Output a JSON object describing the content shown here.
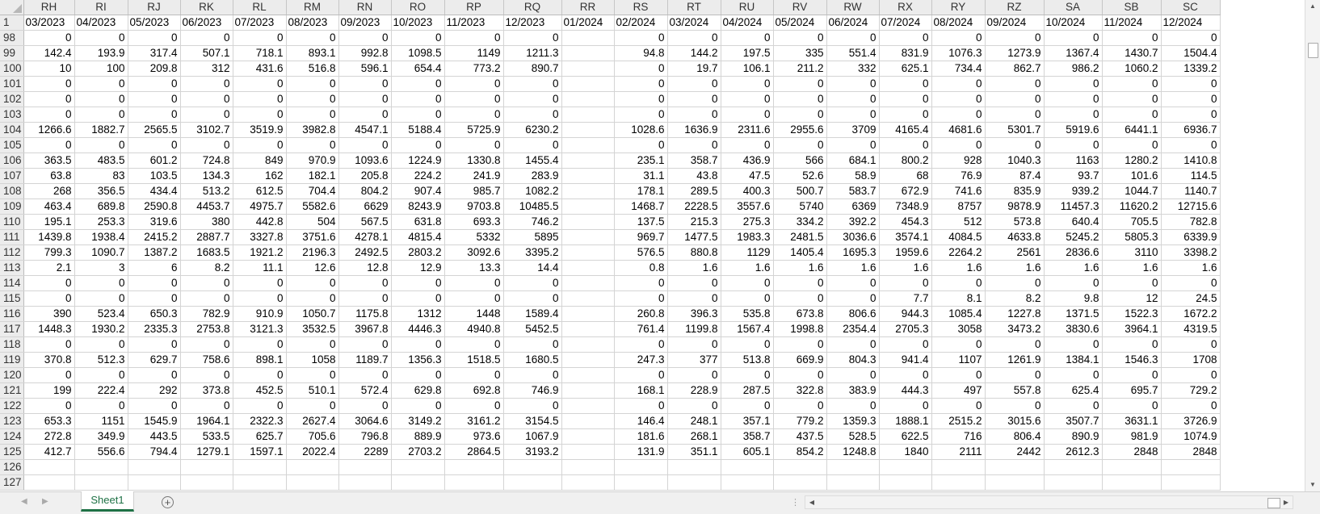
{
  "sheet": {
    "column_headers": [
      "RH",
      "RI",
      "RJ",
      "RK",
      "RL",
      "RM",
      "RN",
      "RO",
      "RP",
      "RQ",
      "RR",
      "RS",
      "RT",
      "RU",
      "RV",
      "RW",
      "RX",
      "RY",
      "RZ",
      "SA",
      "SB",
      "SC"
    ],
    "rows": [
      {
        "row": "1",
        "cells": [
          "03/2023",
          "04/2023",
          "05/2023",
          "06/2023",
          "07/2023",
          "08/2023",
          "09/2023",
          "10/2023",
          "11/2023",
          "12/2023",
          "01/2024",
          "02/2024",
          "03/2024",
          "04/2024",
          "05/2024",
          "06/2024",
          "07/2024",
          "08/2024",
          "09/2024",
          "10/2024",
          "11/2024",
          "12/2024"
        ]
      },
      {
        "row": "98",
        "cells": [
          "0",
          "0",
          "0",
          "0",
          "0",
          "0",
          "0",
          "0",
          "0",
          "0",
          "",
          "0",
          "0",
          "0",
          "0",
          "0",
          "0",
          "0",
          "0",
          "0",
          "0",
          "0"
        ]
      },
      {
        "row": "99",
        "cells": [
          "142.4",
          "193.9",
          "317.4",
          "507.1",
          "718.1",
          "893.1",
          "992.8",
          "1098.5",
          "1149",
          "1211.3",
          "",
          "94.8",
          "144.2",
          "197.5",
          "335",
          "551.4",
          "831.9",
          "1076.3",
          "1273.9",
          "1367.4",
          "1430.7",
          "1504.4"
        ]
      },
      {
        "row": "100",
        "cells": [
          "10",
          "100",
          "209.8",
          "312",
          "431.6",
          "516.8",
          "596.1",
          "654.4",
          "773.2",
          "890.7",
          "",
          "0",
          "19.7",
          "106.1",
          "211.2",
          "332",
          "625.1",
          "734.4",
          "862.7",
          "986.2",
          "1060.2",
          "1339.2"
        ]
      },
      {
        "row": "101",
        "cells": [
          "0",
          "0",
          "0",
          "0",
          "0",
          "0",
          "0",
          "0",
          "0",
          "0",
          "",
          "0",
          "0",
          "0",
          "0",
          "0",
          "0",
          "0",
          "0",
          "0",
          "0",
          "0"
        ]
      },
      {
        "row": "102",
        "cells": [
          "0",
          "0",
          "0",
          "0",
          "0",
          "0",
          "0",
          "0",
          "0",
          "0",
          "",
          "0",
          "0",
          "0",
          "0",
          "0",
          "0",
          "0",
          "0",
          "0",
          "0",
          "0"
        ]
      },
      {
        "row": "103",
        "cells": [
          "0",
          "0",
          "0",
          "0",
          "0",
          "0",
          "0",
          "0",
          "0",
          "0",
          "",
          "0",
          "0",
          "0",
          "0",
          "0",
          "0",
          "0",
          "0",
          "0",
          "0",
          "0"
        ]
      },
      {
        "row": "104",
        "cells": [
          "1266.6",
          "1882.7",
          "2565.5",
          "3102.7",
          "3519.9",
          "3982.8",
          "4547.1",
          "5188.4",
          "5725.9",
          "6230.2",
          "",
          "1028.6",
          "1636.9",
          "2311.6",
          "2955.6",
          "3709",
          "4165.4",
          "4681.6",
          "5301.7",
          "5919.6",
          "6441.1",
          "6936.7"
        ]
      },
      {
        "row": "105",
        "cells": [
          "0",
          "0",
          "0",
          "0",
          "0",
          "0",
          "0",
          "0",
          "0",
          "0",
          "",
          "0",
          "0",
          "0",
          "0",
          "0",
          "0",
          "0",
          "0",
          "0",
          "0",
          "0"
        ]
      },
      {
        "row": "106",
        "cells": [
          "363.5",
          "483.5",
          "601.2",
          "724.8",
          "849",
          "970.9",
          "1093.6",
          "1224.9",
          "1330.8",
          "1455.4",
          "",
          "235.1",
          "358.7",
          "436.9",
          "566",
          "684.1",
          "800.2",
          "928",
          "1040.3",
          "1163",
          "1280.2",
          "1410.8"
        ]
      },
      {
        "row": "107",
        "cells": [
          "63.8",
          "83",
          "103.5",
          "134.3",
          "162",
          "182.1",
          "205.8",
          "224.2",
          "241.9",
          "283.9",
          "",
          "31.1",
          "43.8",
          "47.5",
          "52.6",
          "58.9",
          "68",
          "76.9",
          "87.4",
          "93.7",
          "101.6",
          "114.5"
        ]
      },
      {
        "row": "108",
        "cells": [
          "268",
          "356.5",
          "434.4",
          "513.2",
          "612.5",
          "704.4",
          "804.2",
          "907.4",
          "985.7",
          "1082.2",
          "",
          "178.1",
          "289.5",
          "400.3",
          "500.7",
          "583.7",
          "672.9",
          "741.6",
          "835.9",
          "939.2",
          "1044.7",
          "1140.7"
        ]
      },
      {
        "row": "109",
        "cells": [
          "463.4",
          "689.8",
          "2590.8",
          "4453.7",
          "4975.7",
          "5582.6",
          "6629",
          "8243.9",
          "9703.8",
          "10485.5",
          "",
          "1468.7",
          "2228.5",
          "3557.6",
          "5740",
          "6369",
          "7348.9",
          "8757",
          "9878.9",
          "11457.3",
          "11620.2",
          "12715.6"
        ]
      },
      {
        "row": "110",
        "cells": [
          "195.1",
          "253.3",
          "319.6",
          "380",
          "442.8",
          "504",
          "567.5",
          "631.8",
          "693.3",
          "746.2",
          "",
          "137.5",
          "215.3",
          "275.3",
          "334.2",
          "392.2",
          "454.3",
          "512",
          "573.8",
          "640.4",
          "705.5",
          "782.8"
        ]
      },
      {
        "row": "111",
        "cells": [
          "1439.8",
          "1938.4",
          "2415.2",
          "2887.7",
          "3327.8",
          "3751.6",
          "4278.1",
          "4815.4",
          "5332",
          "5895",
          "",
          "969.7",
          "1477.5",
          "1983.3",
          "2481.5",
          "3036.6",
          "3574.1",
          "4084.5",
          "4633.8",
          "5245.2",
          "5805.3",
          "6339.9"
        ]
      },
      {
        "row": "112",
        "cells": [
          "799.3",
          "1090.7",
          "1387.2",
          "1683.5",
          "1921.2",
          "2196.3",
          "2492.5",
          "2803.2",
          "3092.6",
          "3395.2",
          "",
          "576.5",
          "880.8",
          "1129",
          "1405.4",
          "1695.3",
          "1959.6",
          "2264.2",
          "2561",
          "2836.6",
          "3110",
          "3398.2"
        ]
      },
      {
        "row": "113",
        "cells": [
          "2.1",
          "3",
          "6",
          "8.2",
          "11.1",
          "12.6",
          "12.8",
          "12.9",
          "13.3",
          "14.4",
          "",
          "0.8",
          "1.6",
          "1.6",
          "1.6",
          "1.6",
          "1.6",
          "1.6",
          "1.6",
          "1.6",
          "1.6",
          "1.6"
        ]
      },
      {
        "row": "114",
        "cells": [
          "0",
          "0",
          "0",
          "0",
          "0",
          "0",
          "0",
          "0",
          "0",
          "0",
          "",
          "0",
          "0",
          "0",
          "0",
          "0",
          "0",
          "0",
          "0",
          "0",
          "0",
          "0"
        ]
      },
      {
        "row": "115",
        "cells": [
          "0",
          "0",
          "0",
          "0",
          "0",
          "0",
          "0",
          "0",
          "0",
          "0",
          "",
          "0",
          "0",
          "0",
          "0",
          "0",
          "7.7",
          "8.1",
          "8.2",
          "9.8",
          "12",
          "24.5"
        ]
      },
      {
        "row": "116",
        "cells": [
          "390",
          "523.4",
          "650.3",
          "782.9",
          "910.9",
          "1050.7",
          "1175.8",
          "1312",
          "1448",
          "1589.4",
          "",
          "260.8",
          "396.3",
          "535.8",
          "673.8",
          "806.6",
          "944.3",
          "1085.4",
          "1227.8",
          "1371.5",
          "1522.3",
          "1672.2"
        ]
      },
      {
        "row": "117",
        "cells": [
          "1448.3",
          "1930.2",
          "2335.3",
          "2753.8",
          "3121.3",
          "3532.5",
          "3967.8",
          "4446.3",
          "4940.8",
          "5452.5",
          "",
          "761.4",
          "1199.8",
          "1567.4",
          "1998.8",
          "2354.4",
          "2705.3",
          "3058",
          "3473.2",
          "3830.6",
          "3964.1",
          "4319.5"
        ]
      },
      {
        "row": "118",
        "cells": [
          "0",
          "0",
          "0",
          "0",
          "0",
          "0",
          "0",
          "0",
          "0",
          "0",
          "",
          "0",
          "0",
          "0",
          "0",
          "0",
          "0",
          "0",
          "0",
          "0",
          "0",
          "0"
        ]
      },
      {
        "row": "119",
        "cells": [
          "370.8",
          "512.3",
          "629.7",
          "758.6",
          "898.1",
          "1058",
          "1189.7",
          "1356.3",
          "1518.5",
          "1680.5",
          "",
          "247.3",
          "377",
          "513.8",
          "669.9",
          "804.3",
          "941.4",
          "1107",
          "1261.9",
          "1384.1",
          "1546.3",
          "1708"
        ]
      },
      {
        "row": "120",
        "cells": [
          "0",
          "0",
          "0",
          "0",
          "0",
          "0",
          "0",
          "0",
          "0",
          "0",
          "",
          "0",
          "0",
          "0",
          "0",
          "0",
          "0",
          "0",
          "0",
          "0",
          "0",
          "0"
        ]
      },
      {
        "row": "121",
        "cells": [
          "199",
          "222.4",
          "292",
          "373.8",
          "452.5",
          "510.1",
          "572.4",
          "629.8",
          "692.8",
          "746.9",
          "",
          "168.1",
          "228.9",
          "287.5",
          "322.8",
          "383.9",
          "444.3",
          "497",
          "557.8",
          "625.4",
          "695.7",
          "729.2"
        ]
      },
      {
        "row": "122",
        "cells": [
          "0",
          "0",
          "0",
          "0",
          "0",
          "0",
          "0",
          "0",
          "0",
          "0",
          "",
          "0",
          "0",
          "0",
          "0",
          "0",
          "0",
          "0",
          "0",
          "0",
          "0",
          "0"
        ]
      },
      {
        "row": "123",
        "cells": [
          "653.3",
          "1151",
          "1545.9",
          "1964.1",
          "2322.3",
          "2627.4",
          "3064.6",
          "3149.2",
          "3161.2",
          "3154.5",
          "",
          "146.4",
          "248.1",
          "357.1",
          "779.2",
          "1359.3",
          "1888.1",
          "2515.2",
          "3015.6",
          "3507.7",
          "3631.1",
          "3726.9"
        ]
      },
      {
        "row": "124",
        "cells": [
          "272.8",
          "349.9",
          "443.5",
          "533.5",
          "625.7",
          "705.6",
          "796.8",
          "889.9",
          "973.6",
          "1067.9",
          "",
          "181.6",
          "268.1",
          "358.7",
          "437.5",
          "528.5",
          "622.5",
          "716",
          "806.4",
          "890.9",
          "981.9",
          "1074.9"
        ]
      },
      {
        "row": "125",
        "cells": [
          "412.7",
          "556.6",
          "794.4",
          "1279.1",
          "1597.1",
          "2022.4",
          "2289",
          "2703.2",
          "2864.5",
          "3193.2",
          "",
          "131.9",
          "351.1",
          "605.1",
          "854.2",
          "1248.8",
          "1840",
          "2111",
          "2442",
          "2612.3",
          "2848",
          "2848"
        ]
      },
      {
        "row": "126",
        "cells": [
          "",
          "",
          "",
          "",
          "",
          "",
          "",
          "",
          "",
          "",
          "",
          "",
          "",
          "",
          "",
          "",
          "",
          "",
          "",
          "",
          "",
          ""
        ]
      },
      {
        "row": "127",
        "cells": [
          "",
          "",
          "",
          "",
          "",
          "",
          "",
          "",
          "",
          "",
          "",
          "",
          "",
          "",
          "",
          "",
          "",
          "",
          "",
          "",
          "",
          ""
        ]
      }
    ]
  },
  "tabs": [
    {
      "label": "Sheet1",
      "active": true
    }
  ],
  "icons": {
    "add_sheet": "plus-circle-icon",
    "nav_prev": "chevron-left-icon",
    "nav_next": "chevron-right-icon",
    "scroll_up": "triangle-up-icon",
    "scroll_down": "triangle-down-icon",
    "scroll_left": "triangle-left-icon",
    "scroll_right": "triangle-right-icon"
  },
  "colors": {
    "accent": "#1e7145",
    "header_bg": "#ececec",
    "gridline": "#d4d4d4"
  }
}
